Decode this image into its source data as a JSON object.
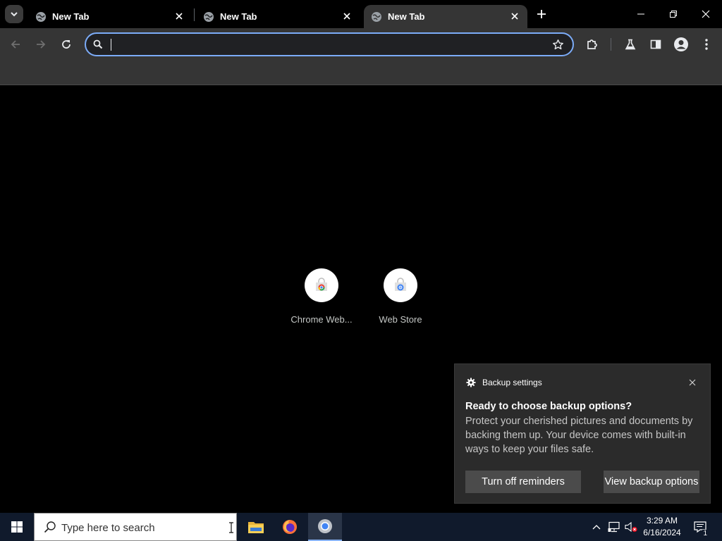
{
  "browser": {
    "tabs": [
      {
        "title": "New Tab",
        "active": false
      },
      {
        "title": "New Tab",
        "active": false
      },
      {
        "title": "New Tab",
        "active": true
      }
    ],
    "omnibox": {
      "value": "",
      "placeholder": ""
    }
  },
  "shortcuts": [
    {
      "label": "Chrome Web...",
      "icon": "chrome-web-store-icon"
    },
    {
      "label": "Web Store",
      "icon": "web-store-icon"
    }
  ],
  "notification": {
    "app_name": "Backup settings",
    "title": "Ready to choose backup options?",
    "body": "Protect your cherished pictures and documents by backing them up. Your device comes with built-in ways to keep your files safe.",
    "buttons": {
      "dismiss": "Turn off reminders",
      "primary": "View backup options"
    }
  },
  "taskbar": {
    "search_placeholder": "Type here to search",
    "apps": [
      "file-explorer-icon",
      "firefox-icon",
      "chrome-icon"
    ],
    "time": "3:29 AM",
    "date": "6/16/2024",
    "notification_count": "1"
  },
  "colors": {
    "accent": "#7cacf8",
    "toolbar": "#353535",
    "taskbar": "#101a2c",
    "toast": "#2b2b2b"
  }
}
